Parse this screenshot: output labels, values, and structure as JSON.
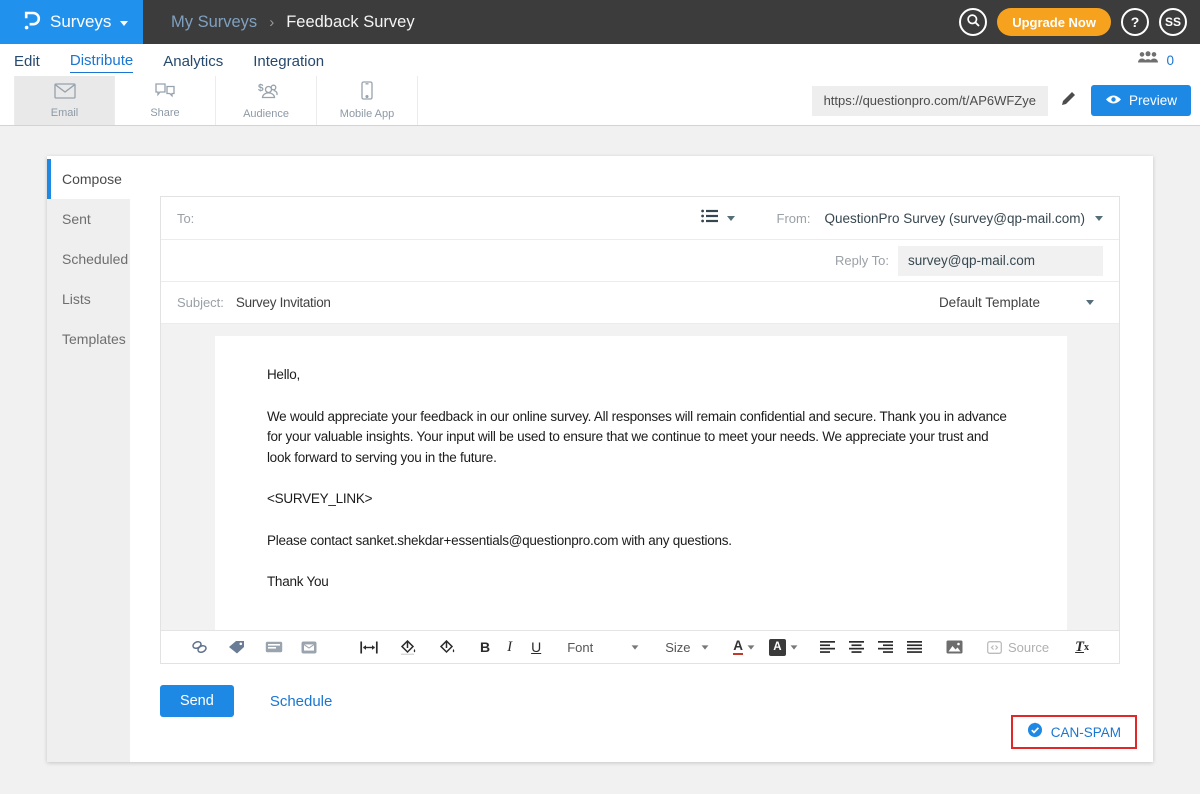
{
  "colors": {
    "header_dark": "#3c3c3c",
    "brand_blue": "#2191ee",
    "accent_blue": "#1e88e5",
    "nav_blue": "#1976d2",
    "upgrade_orange": "#f6a21e",
    "canspam_red": "#e12727",
    "page_bg": "#f1f1f1"
  },
  "header": {
    "brand": {
      "product_label": "Surveys",
      "logo_icon": "questionpro-logo"
    },
    "breadcrumb": {
      "parent": "My Surveys",
      "separator": "›",
      "current": "Feedback Survey"
    },
    "actions": {
      "search_icon": "search-icon",
      "upgrade_label": "Upgrade Now",
      "help_label": "?",
      "avatar_initials": "SS"
    }
  },
  "nav": {
    "tabs": [
      {
        "label": "Edit",
        "active": false
      },
      {
        "label": "Distribute",
        "active": true
      },
      {
        "label": "Analytics",
        "active": false
      },
      {
        "label": "Integration",
        "active": false
      }
    ],
    "collaborators_count": "0"
  },
  "distribute_toolbar": {
    "channels": [
      {
        "label": "Email",
        "icon": "envelope-icon",
        "active": true
      },
      {
        "label": "Share",
        "icon": "speech-bubbles-icon",
        "active": false
      },
      {
        "label": "Audience",
        "icon": "audience-dollar-people-icon",
        "active": false
      },
      {
        "label": "Mobile App",
        "icon": "smartphone-icon",
        "active": false
      }
    ],
    "survey_url": "https://questionpro.com/t/AP6WFZye",
    "preview_label": "Preview"
  },
  "sidebar": {
    "items": [
      {
        "label": "Compose",
        "active": true
      },
      {
        "label": "Sent",
        "active": false
      },
      {
        "label": "Scheduled",
        "active": false
      },
      {
        "label": "Lists",
        "active": false
      },
      {
        "label": "Templates",
        "active": false
      }
    ]
  },
  "compose": {
    "to_label": "To:",
    "from_label": "From:",
    "from_value": "QuestionPro Survey (survey@qp-mail.com)",
    "reply_to_label": "Reply To:",
    "reply_to_value": "survey@qp-mail.com",
    "subject_label": "Subject:",
    "subject_value": "Survey Invitation",
    "template_value": "Default Template",
    "body": {
      "p0": "Hello,",
      "p1": "We would appreciate your feedback in our online survey. All responses will remain confidential and secure. Thank you in advance for your valuable insights. Your input will be used to ensure that we continue to meet your needs. We appreciate your trust and look forward to serving you in the future.",
      "p2": "<SURVEY_LINK>",
      "p3": "Please contact sanket.shekdar+essentials@questionpro.com with any questions.",
      "p4": "Thank You"
    },
    "editor_toolbar": {
      "bold_label": "B",
      "italic_label": "I",
      "underline_label": "U",
      "font_label": "Font",
      "size_label": "Size",
      "text_color_label": "A",
      "bg_color_label": "A",
      "source_label": "Source",
      "remove_format_t": "T",
      "remove_format_x": "x"
    },
    "send_label": "Send",
    "schedule_label": "Schedule",
    "can_spam_label": "CAN-SPAM"
  }
}
